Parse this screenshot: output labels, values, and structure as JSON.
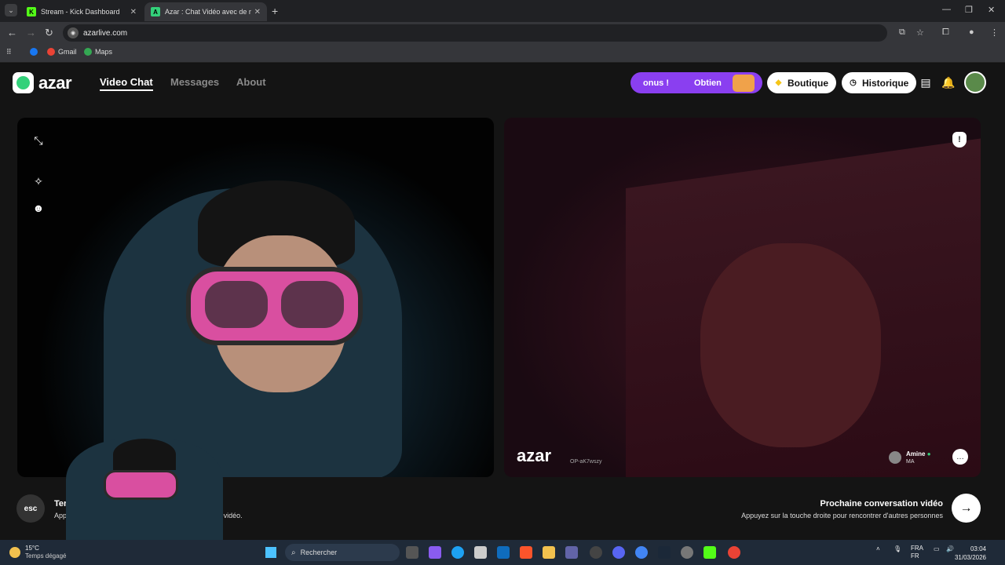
{
  "browser": {
    "tabs": [
      {
        "title": "Stream - Kick Dashboard",
        "favicon": "K"
      },
      {
        "title": "Azar : Chat Vidéo avec de n",
        "favicon": "A"
      }
    ],
    "url": "azarlive.com",
    "bookmarks": [
      "Gmail",
      "Maps"
    ]
  },
  "header": {
    "logo": "azar",
    "nav": [
      "Video Chat",
      "Messages",
      "About"
    ],
    "promo_text_1": "onus !",
    "promo_text_2": "Obtien",
    "boutique": "Boutique",
    "historique": "Historique"
  },
  "remote": {
    "watermark": "azar",
    "watermark_id": "OP-aK7wszy",
    "user_name": "Amine",
    "user_country": "MA"
  },
  "footer": {
    "esc_label": "esc",
    "end_title": "Termin",
    "end_desc": "Appu",
    "end_desc_tail": "au chat vidéo.",
    "next_title": "Prochaine conversation vidéo",
    "next_desc": "Appuyez sur la touche droite pour rencontrer d'autres personnes"
  },
  "taskbar": {
    "temp": "15°C",
    "weather": "Temps dégagé",
    "search_placeholder": "Rechercher",
    "lang_1": "FRA",
    "lang_2": "FR",
    "time": "03:04",
    "date": "31/03/2026"
  },
  "colors": {
    "accent_green": "#33d17a",
    "promo_purple": "#8a3ff0"
  }
}
